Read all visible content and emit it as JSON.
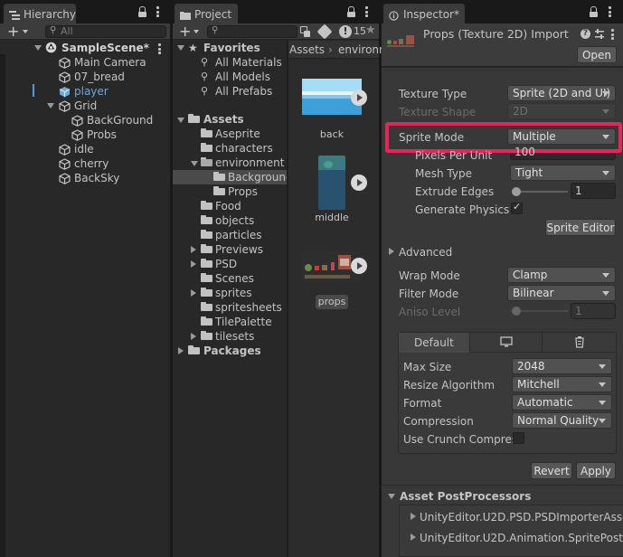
{
  "hierarchy": {
    "tab_label": "Hierarchy",
    "search_placeholder": "All",
    "items": [
      {
        "label": "SampleScene*",
        "type": "scene"
      },
      {
        "label": "Main Camera",
        "type": "object"
      },
      {
        "label": "07_bread",
        "type": "object"
      },
      {
        "label": "player",
        "type": "object",
        "selected_color": "#5a95dc"
      },
      {
        "label": "Grid",
        "type": "object"
      },
      {
        "label": "BackGround",
        "type": "object"
      },
      {
        "label": "Probs",
        "type": "object"
      },
      {
        "label": "idle",
        "type": "object"
      },
      {
        "label": "cherry",
        "type": "object"
      },
      {
        "label": "BackSky",
        "type": "object"
      }
    ]
  },
  "project": {
    "tab_label": "Project",
    "favorites": {
      "label": "Favorites",
      "items": [
        "All Materials",
        "All Models",
        "All Prefabs"
      ]
    },
    "assets": {
      "label": "Assets",
      "items": [
        "Aseprite",
        "characters",
        "environment",
        "Background",
        "Props",
        "Food",
        "objects",
        "particles",
        "Previews",
        "PSD",
        "Scenes",
        "sprites",
        "spritesheets",
        "TilePalette",
        "tilesets"
      ]
    },
    "packages_label": "Packages",
    "breadcrumb": [
      "Assets",
      "environm"
    ],
    "hidden_count": "15",
    "grid": [
      {
        "label": "back"
      },
      {
        "label": "middle"
      },
      {
        "label": "props"
      }
    ]
  },
  "inspector": {
    "tab_label": "Inspector*",
    "title": "Props (Texture 2D) Import",
    "open_button": "Open",
    "fields": {
      "texture_type": {
        "label": "Texture Type",
        "value": "Sprite (2D and UI)"
      },
      "texture_shape": {
        "label": "Texture Shape",
        "value": "2D"
      },
      "sprite_mode": {
        "label": "Sprite Mode",
        "value": "Multiple"
      },
      "pixels_per_unit": {
        "label": "Pixels Per Unit",
        "value": "100"
      },
      "mesh_type": {
        "label": "Mesh Type",
        "value": "Tight"
      },
      "extrude_edges": {
        "label": "Extrude Edges",
        "value": "1"
      },
      "generate_physics": {
        "label": "Generate Physics S",
        "checked": true
      }
    },
    "sprite_editor_button": "Sprite Editor",
    "advanced_label": "Advanced",
    "wrap_mode": {
      "label": "Wrap Mode",
      "value": "Clamp"
    },
    "filter_mode": {
      "label": "Filter Mode",
      "value": "Bilinear"
    },
    "aniso_level": {
      "label": "Aniso Level",
      "value": "1"
    },
    "platform_tabs": {
      "default_label": "Default"
    },
    "platform": {
      "max_size": {
        "label": "Max Size",
        "value": "2048"
      },
      "resize_algorithm": {
        "label": "Resize Algorithm",
        "value": "Mitchell"
      },
      "format": {
        "label": "Format",
        "value": "Automatic"
      },
      "compression": {
        "label": "Compression",
        "value": "Normal Quality"
      },
      "crunch": {
        "label": "Use Crunch Compres",
        "checked": false
      }
    },
    "revert_button": "Revert",
    "apply_button": "Apply",
    "postprocessors": {
      "label": "Asset PostProcessors",
      "items": [
        "UnityEditor.U2D.PSD.PSDImporterAsset",
        "UnityEditor.U2D.Animation.SpritePostPr"
      ]
    },
    "highlight_color": "#e8245a"
  }
}
